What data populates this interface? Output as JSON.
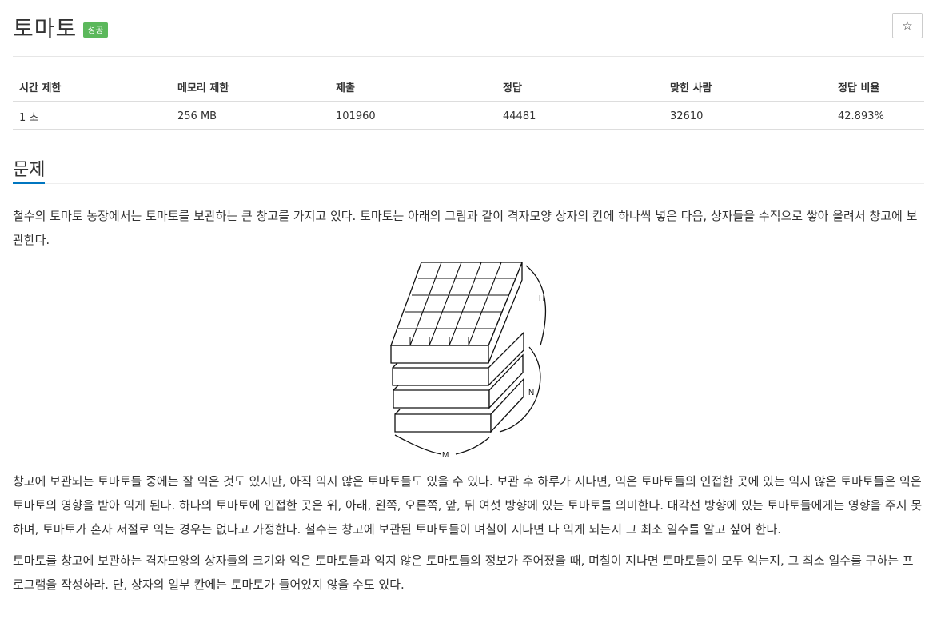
{
  "problem": {
    "title": "토마토",
    "badge": "성공",
    "star": "☆"
  },
  "info_table": {
    "headers": [
      "시간 제한",
      "메모리 제한",
      "제출",
      "정답",
      "맞힌 사람",
      "정답 비율"
    ],
    "values": [
      "1 초",
      "256 MB",
      "101960",
      "44481",
      "32610",
      "42.893%"
    ]
  },
  "section": {
    "title": "문제",
    "paragraphs": [
      "철수의 토마토 농장에서는 토마토를 보관하는 큰 창고를 가지고 있다. 토마토는 아래의 그림과 같이 격자모양 상자의 칸에 하나씩 넣은 다음, 상자들을 수직으로 쌓아 올려서 창고에 보관한다.",
      "창고에 보관되는 토마토들 중에는 잘 익은 것도 있지만, 아직 익지 않은 토마토들도 있을 수 있다. 보관 후 하루가 지나면, 익은 토마토들의 인접한 곳에 있는 익지 않은 토마토들은 익은 토마토의 영향을 받아 익게 된다. 하나의 토마토에 인접한 곳은 위, 아래, 왼쪽, 오른쪽, 앞, 뒤 여섯 방향에 있는 토마토를 의미한다. 대각선 방향에 있는 토마토들에게는 영향을 주지 못하며, 토마토가 혼자 저절로 익는 경우는 없다고 가정한다. 철수는 창고에 보관된 토마토들이 며칠이 지나면 다 익게 되는지 그 최소 일수를 알고 싶어 한다.",
      "토마토를 창고에 보관하는 격자모양의 상자들의 크기와 익은 토마토들과 익지 않은 토마토들의 정보가 주어졌을 때, 며칠이 지나면 토마토들이 모두 익는지, 그 최소 일수를 구하는 프로그램을 작성하라. 단, 상자의 일부 칸에는 토마토가 들어있지 않을 수도 있다."
    ]
  },
  "figure_labels": {
    "h": "H",
    "n": "N",
    "m": "M"
  }
}
